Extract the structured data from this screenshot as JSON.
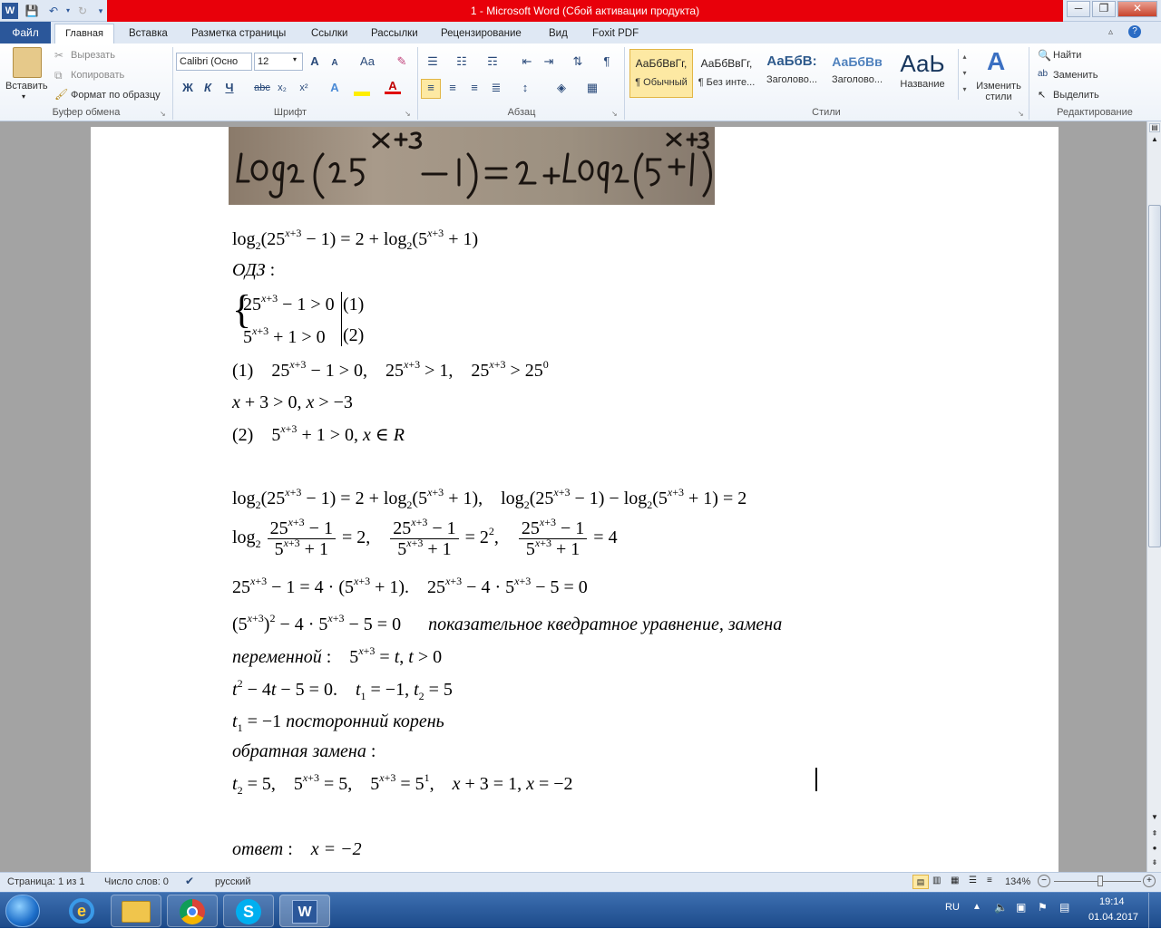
{
  "window": {
    "title": "1 - Microsoft Word (Сбой активации продукта)",
    "minimize_glyph": "─",
    "maximize_glyph": "❐",
    "close_glyph": "✕"
  },
  "tabs": {
    "file": "Файл",
    "items": [
      "Главная",
      "Вставка",
      "Разметка страницы",
      "Ссылки",
      "Рассылки",
      "Рецензирование",
      "Вид",
      "Foxit PDF"
    ]
  },
  "ribbon": {
    "clipboard": {
      "paste": "Вставить",
      "cut": "Вырезать",
      "copy": "Копировать",
      "format_painter": "Формат по образцу",
      "label": "Буфер обмена"
    },
    "font": {
      "font_name": "Calibri (Осно",
      "font_size": "12",
      "label": "Шрифт",
      "grow": "A",
      "shrink": "A",
      "case": "Aa",
      "bold": "Ж",
      "italic": "К",
      "underline": "Ч",
      "strike": "abc",
      "sub": "x₂",
      "sup": "x²"
    },
    "paragraph": {
      "label": "Абзац",
      "pilcrow": "¶"
    },
    "styles": {
      "label": "Стили",
      "items": [
        {
          "sample": "АаБбВвГг,",
          "name": "¶ Обычный"
        },
        {
          "sample": "АаБбВвГг,",
          "name": "¶ Без инте..."
        },
        {
          "sample": "АаБбВ:",
          "name": "Заголово..."
        },
        {
          "sample": "АаБбВв",
          "name": "Заголово..."
        },
        {
          "sample": "АаЬ",
          "name": "Название"
        }
      ],
      "change_styles": "Изменить стили"
    },
    "editing": {
      "label": "Редактирование",
      "find": "Найти",
      "replace": "Заменить",
      "select": "Выделить"
    }
  },
  "document": {
    "l1_text": "ОДЗ",
    "l_side": "посторонний корень",
    "l_obr": "обратная замена",
    "l_pok": "показательное кведратное уравнение, замена",
    "l_per": "переменной",
    "l_ans": "ответ",
    "l_ans_val": "x = −2"
  },
  "statusbar": {
    "page": "Страница: 1 из 1",
    "words": "Число слов: 0",
    "lang": "русский",
    "zoom": "134%"
  },
  "taskbar": {
    "lang": "RU",
    "time": "19:14",
    "date": "01.04.2017"
  }
}
